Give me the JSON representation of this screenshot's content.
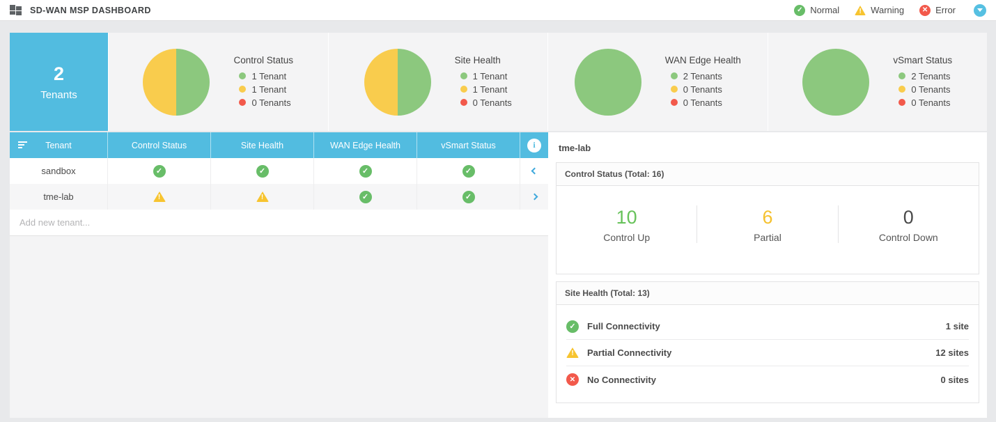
{
  "colors": {
    "blue": "#52bce0",
    "pie-green": "#8cc87e",
    "pie-yellow": "#f9cc4d",
    "pie-red": "#f2594b",
    "ok": "#68bd68",
    "warning": "#f7c430",
    "error": "#f2594b",
    "chevron": "#3fa9dc"
  },
  "header": {
    "title": "SD-WAN MSP DASHBOARD",
    "status_legend": [
      {
        "state": "ok",
        "label": "Normal"
      },
      {
        "state": "warning",
        "label": "Warning"
      },
      {
        "state": "error",
        "label": "Error"
      }
    ]
  },
  "summary": {
    "tile": {
      "count": "2",
      "label": "Tenants"
    },
    "charts": [
      {
        "type": "pie",
        "title": "Control Status",
        "slices": [
          {
            "color": "pie-green",
            "pct": 50
          },
          {
            "color": "pie-yellow",
            "pct": 50
          },
          {
            "color": "pie-red",
            "pct": 0
          }
        ],
        "legend": [
          {
            "state": "green",
            "label": "1 Tenant"
          },
          {
            "state": "yellow",
            "label": "1 Tenant"
          },
          {
            "state": "red",
            "label": "0 Tenants"
          }
        ]
      },
      {
        "type": "pie",
        "title": "Site Health",
        "slices": [
          {
            "color": "pie-green",
            "pct": 50
          },
          {
            "color": "pie-yellow",
            "pct": 50
          },
          {
            "color": "pie-red",
            "pct": 0
          }
        ],
        "legend": [
          {
            "state": "green",
            "label": "1 Tenant"
          },
          {
            "state": "yellow",
            "label": "1 Tenant"
          },
          {
            "state": "red",
            "label": "0 Tenants"
          }
        ]
      },
      {
        "type": "pie",
        "title": "WAN Edge Health",
        "slices": [
          {
            "color": "pie-green",
            "pct": 100
          },
          {
            "color": "pie-yellow",
            "pct": 0
          },
          {
            "color": "pie-red",
            "pct": 0
          }
        ],
        "legend": [
          {
            "state": "green",
            "label": "2 Tenants"
          },
          {
            "state": "yellow",
            "label": "0 Tenants"
          },
          {
            "state": "red",
            "label": "0 Tenants"
          }
        ]
      },
      {
        "type": "pie",
        "title": "vSmart Status",
        "slices": [
          {
            "color": "pie-green",
            "pct": 100
          },
          {
            "color": "pie-yellow",
            "pct": 0
          },
          {
            "color": "pie-red",
            "pct": 0
          }
        ],
        "legend": [
          {
            "state": "green",
            "label": "2 Tenants"
          },
          {
            "state": "yellow",
            "label": "0 Tenants"
          },
          {
            "state": "red",
            "label": "0 Tenants"
          }
        ]
      }
    ]
  },
  "table": {
    "columns": [
      "Tenant",
      "Control Status",
      "Site Health",
      "WAN Edge Health",
      "vSmart Status"
    ],
    "rows": [
      {
        "tenant": "sandbox",
        "statuses": [
          "ok",
          "ok",
          "ok",
          "ok"
        ],
        "chevron": "left"
      },
      {
        "tenant": "tme-lab",
        "statuses": [
          "warning",
          "warning",
          "ok",
          "ok"
        ],
        "chevron": "right"
      }
    ],
    "add_placeholder": "Add new tenant..."
  },
  "detail": {
    "title": "tme-lab",
    "control_card": {
      "title": "Control Status (Total: 16)",
      "stats": [
        {
          "value": "10",
          "label": "Control Up",
          "tone": "green"
        },
        {
          "value": "6",
          "label": "Partial",
          "tone": "yellow"
        },
        {
          "value": "0",
          "label": "Control Down",
          "tone": "dark"
        }
      ]
    },
    "site_card": {
      "title": "Site Health (Total: 13)",
      "rows": [
        {
          "state": "ok",
          "label": "Full Connectivity",
          "value": "1 site"
        },
        {
          "state": "warning",
          "label": "Partial Connectivity",
          "value": "12 sites"
        },
        {
          "state": "error",
          "label": "No Connectivity",
          "value": "0 sites"
        }
      ]
    }
  }
}
